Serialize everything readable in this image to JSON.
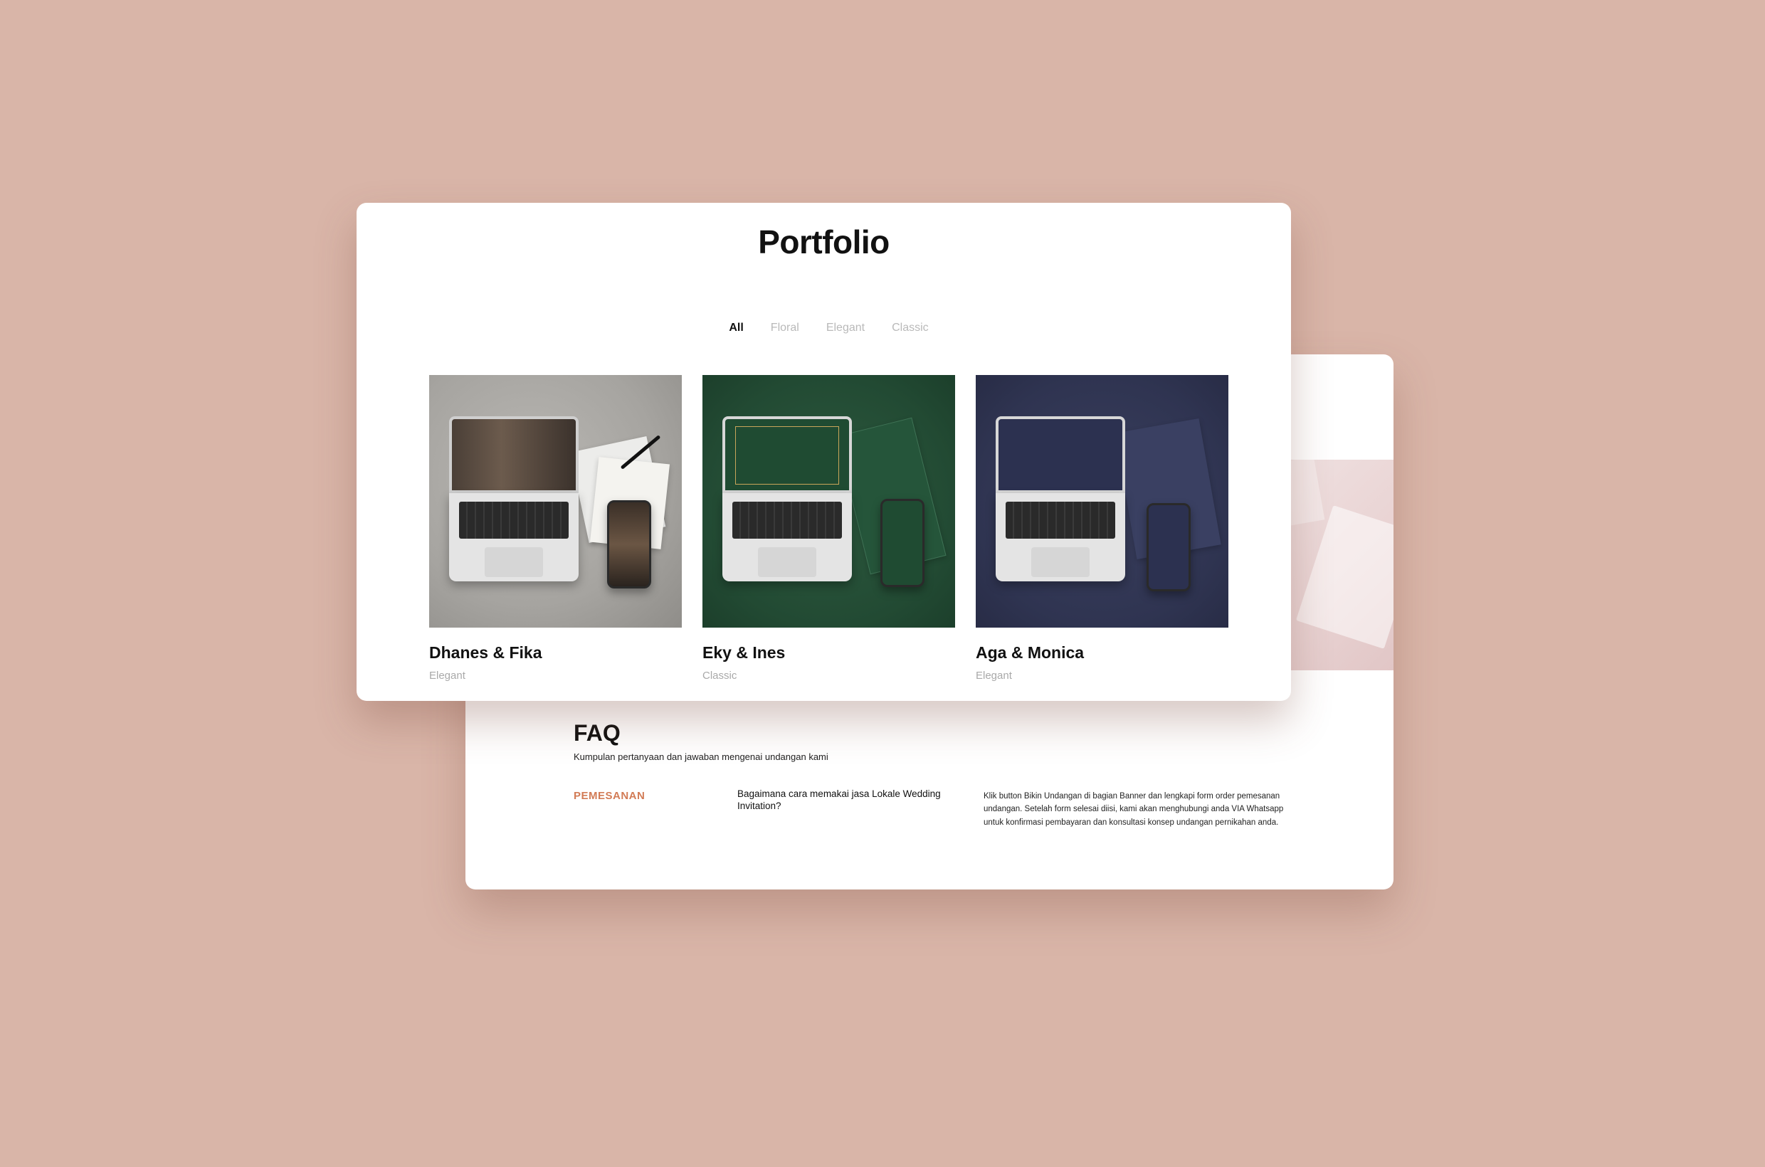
{
  "portfolio": {
    "title": "Portfolio",
    "filters": [
      {
        "label": "All",
        "active": true
      },
      {
        "label": "Floral",
        "active": false
      },
      {
        "label": "Elegant",
        "active": false
      },
      {
        "label": "Classic",
        "active": false
      }
    ],
    "items": [
      {
        "name": "Dhanes & Fika",
        "category": "Elegant",
        "theme": "gray"
      },
      {
        "name": "Eky & Ines",
        "category": "Classic",
        "theme": "green"
      },
      {
        "name": "Aga & Monica",
        "category": "Elegant",
        "theme": "navy"
      }
    ]
  },
  "faq": {
    "title": "FAQ",
    "subtitle": "Kumpulan pertanyaan dan jawaban mengenai undangan kami",
    "category": "PEMESANAN",
    "question": "Bagaimana cara memakai jasa Lokale Wedding Invitation?",
    "answer": "Klik button Bikin Undangan di bagian Banner dan lengkapi form order pemesanan undangan. Setelah form selesai diisi, kami akan menghubungi anda VIA Whatsapp untuk konfirmasi pembayaran dan konsultasi konsep undangan pernikahan anda."
  },
  "colors": {
    "background": "#d9b5a8",
    "accent": "#d27b55"
  }
}
